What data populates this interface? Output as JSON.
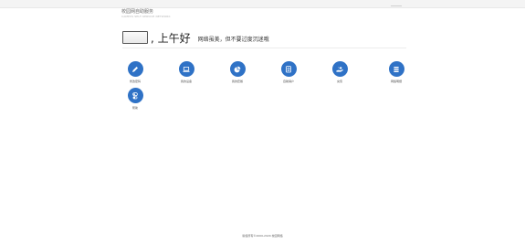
{
  "header": {
    "brand_cn": "校园网自助服务",
    "brand_en": "CAMPUS SELF-SERVICE NETWORK"
  },
  "greeting": {
    "salutation": ", 上午好",
    "motto": "网络虽美，但不要过度沉迷哦"
  },
  "tiles": [
    {
      "label": "修改密码",
      "icon": "pencil-icon"
    },
    {
      "label": "我的设备",
      "icon": "laptop-icon"
    },
    {
      "label": "我的套餐",
      "icon": "pie-chart-icon"
    },
    {
      "label": "自助销户",
      "icon": "document-icon"
    },
    {
      "label": "充值",
      "icon": "payment-hand-icon"
    },
    {
      "label": "网络明细",
      "icon": "list-icon"
    },
    {
      "label": "帮助",
      "icon": "help-toggle-icon"
    }
  ],
  "footer": {
    "text": "版权所有©2000-2020 校园网络"
  },
  "colors": {
    "accent": "#2f72c6",
    "background": "#ffffff"
  }
}
